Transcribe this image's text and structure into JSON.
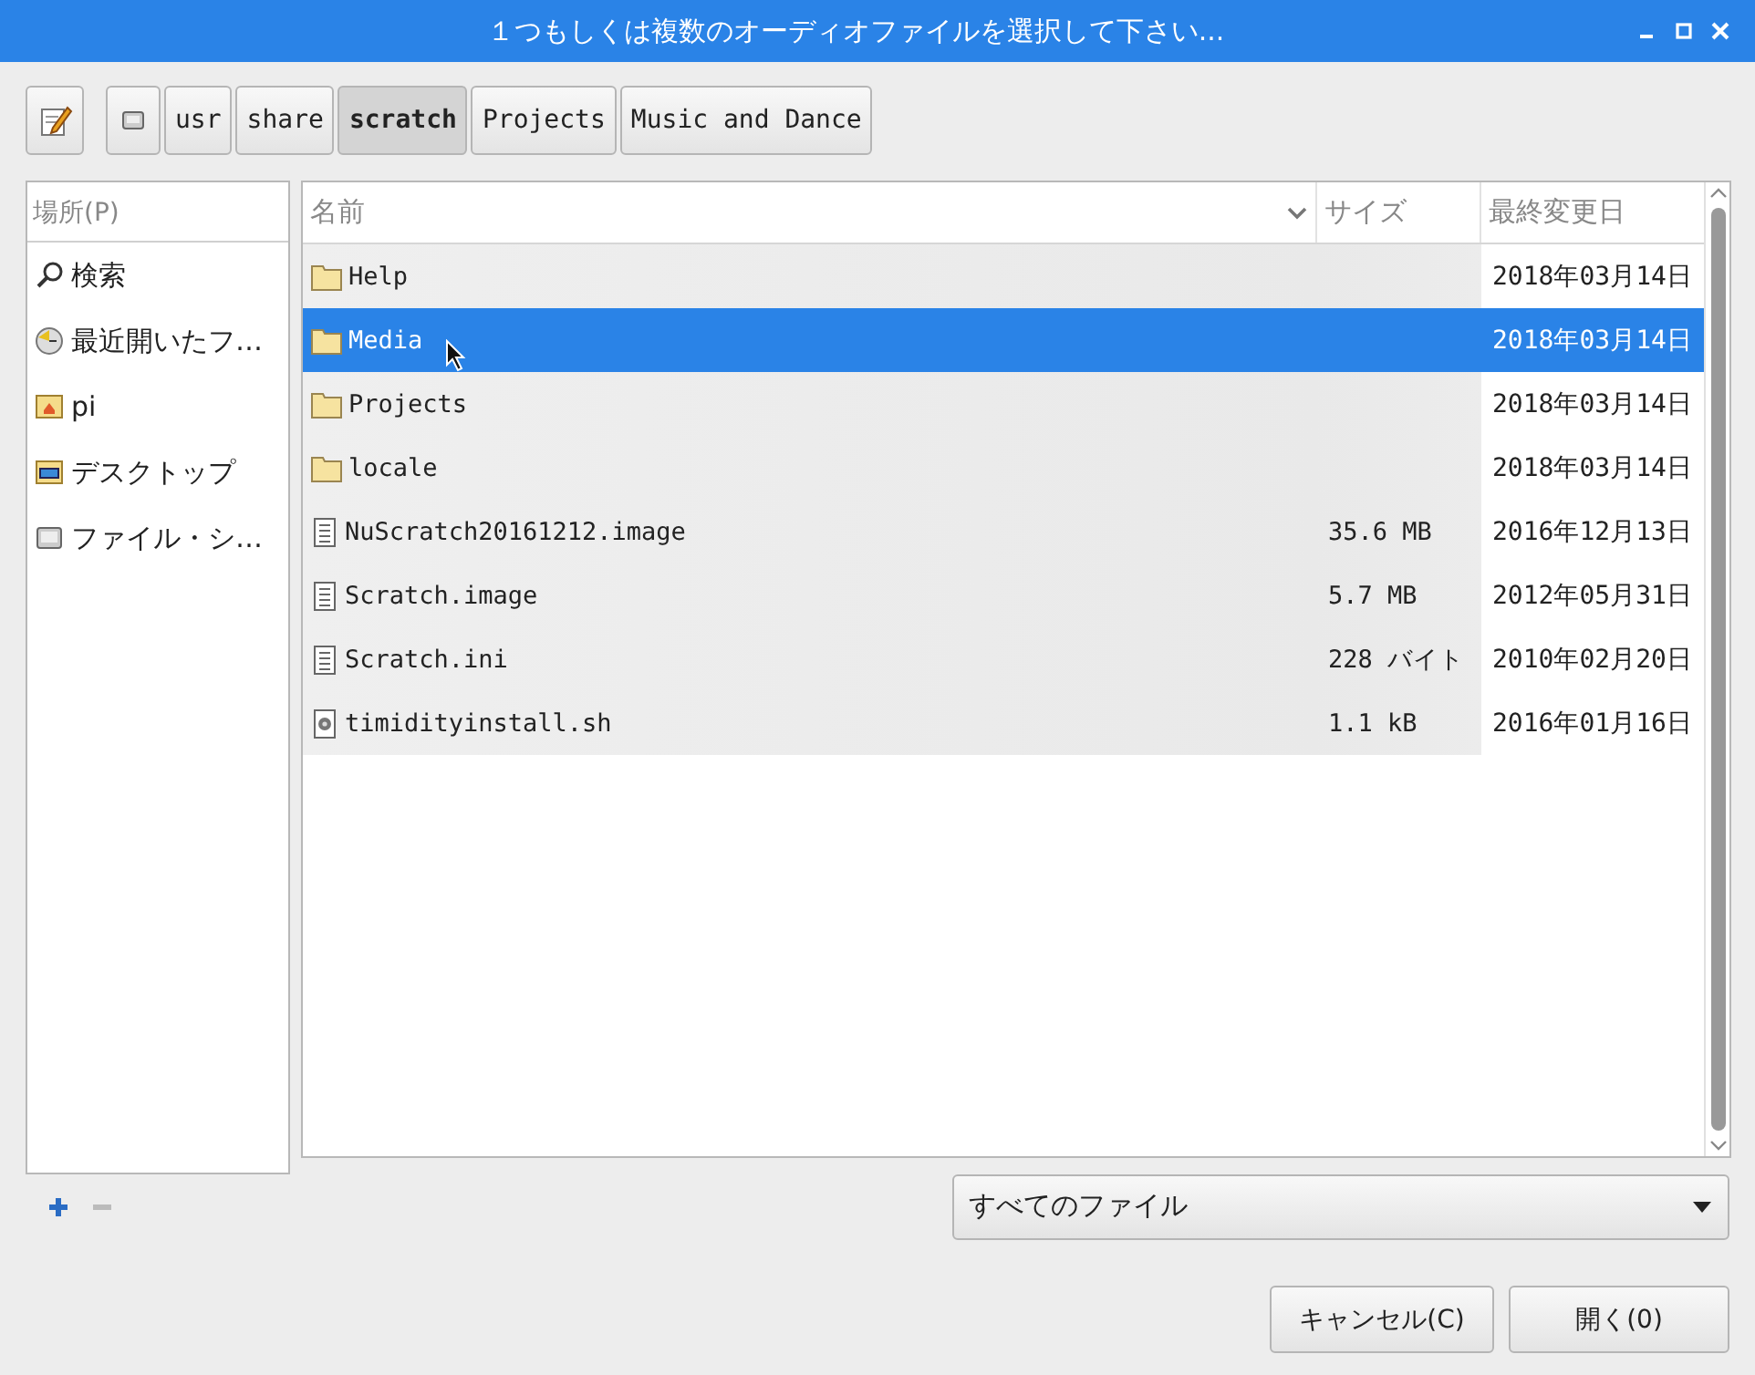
{
  "window": {
    "title": "１つもしくは複数のオーディオファイルを選択して下さい..."
  },
  "path_bar": {
    "buttons": [
      {
        "kind": "drive",
        "selected": false
      },
      {
        "kind": "text",
        "label": "usr",
        "selected": false
      },
      {
        "kind": "text",
        "label": "share",
        "selected": false
      },
      {
        "kind": "text",
        "label": "scratch",
        "selected": true
      },
      {
        "kind": "text",
        "label": "Projects",
        "selected": false
      },
      {
        "kind": "text",
        "label": "Music and Dance",
        "selected": false
      }
    ]
  },
  "sidebar": {
    "header": "場所(P)",
    "items": [
      {
        "kind": "search",
        "label": "検索"
      },
      {
        "kind": "recent",
        "label": "最近開いたフ…"
      },
      {
        "kind": "home",
        "label": "pi"
      },
      {
        "kind": "desktop",
        "label": "デスクトップ"
      },
      {
        "kind": "drive",
        "label": "ファイル・シ…"
      }
    ],
    "add_enabled": true,
    "remove_enabled": false
  },
  "table": {
    "columns": [
      {
        "label": "名前",
        "sorted": true
      },
      {
        "label": "サイズ",
        "sorted": false
      },
      {
        "label": "最終変更日",
        "sorted": false
      }
    ],
    "rows": [
      {
        "kind": "folder",
        "name": "Help",
        "modified": "2018年03月14日",
        "selected": false
      },
      {
        "kind": "folder",
        "name": "Media",
        "modified": "2018年03月14日",
        "selected": true
      },
      {
        "kind": "folder",
        "name": "Projects",
        "modified": "2018年03月14日",
        "selected": false
      },
      {
        "kind": "folder",
        "name": "locale",
        "modified": "2018年03月14日",
        "selected": false
      },
      {
        "kind": "file",
        "name": "NuScratch20161212.image",
        "size": "35.6 MB",
        "modified": "2016年12月13日",
        "selected": false
      },
      {
        "kind": "file",
        "name": "Scratch.image",
        "size": "5.7 MB",
        "modified": "2012年05月31日",
        "selected": false
      },
      {
        "kind": "file",
        "name": "Scratch.ini",
        "size": "228 バイト",
        "modified": "2010年02月20日",
        "selected": false
      },
      {
        "kind": "script",
        "name": "timidityinstall.sh",
        "size": "1.1 kB",
        "modified": "2016年01月16日",
        "selected": false
      }
    ]
  },
  "filter": {
    "value": "すべてのファイル"
  },
  "buttons": [
    {
      "label": "キャンセル(C)"
    },
    {
      "label": "開く(0)"
    }
  ]
}
